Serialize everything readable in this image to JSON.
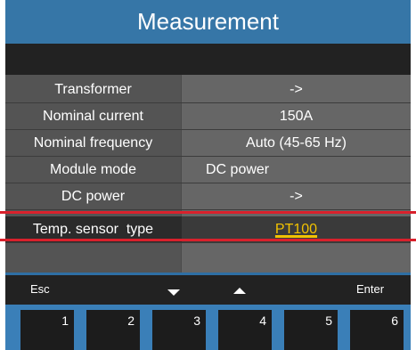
{
  "header": {
    "title": "Measurement"
  },
  "menu": {
    "rows": [
      {
        "label": "Transformer",
        "value": "->"
      },
      {
        "label": "Nominal current",
        "value": "150A"
      },
      {
        "label": "Nominal frequency",
        "value": "Auto (45-65 Hz)"
      },
      {
        "label": "Module mode",
        "value": "DC power"
      },
      {
        "label": "DC power",
        "value": "->"
      },
      {
        "label": "Temp. sensor  type",
        "value": "PT100"
      }
    ]
  },
  "softkeys": {
    "esc_label": "Esc",
    "enter_label": "Enter",
    "keys": [
      "1",
      "2",
      "3",
      "4",
      "5",
      "6"
    ]
  },
  "colors": {
    "title_bar": "#3676a7",
    "highlight_value": "#f2c200",
    "red_marker": "#d9212c",
    "key_bar": "#3a7fb8"
  }
}
